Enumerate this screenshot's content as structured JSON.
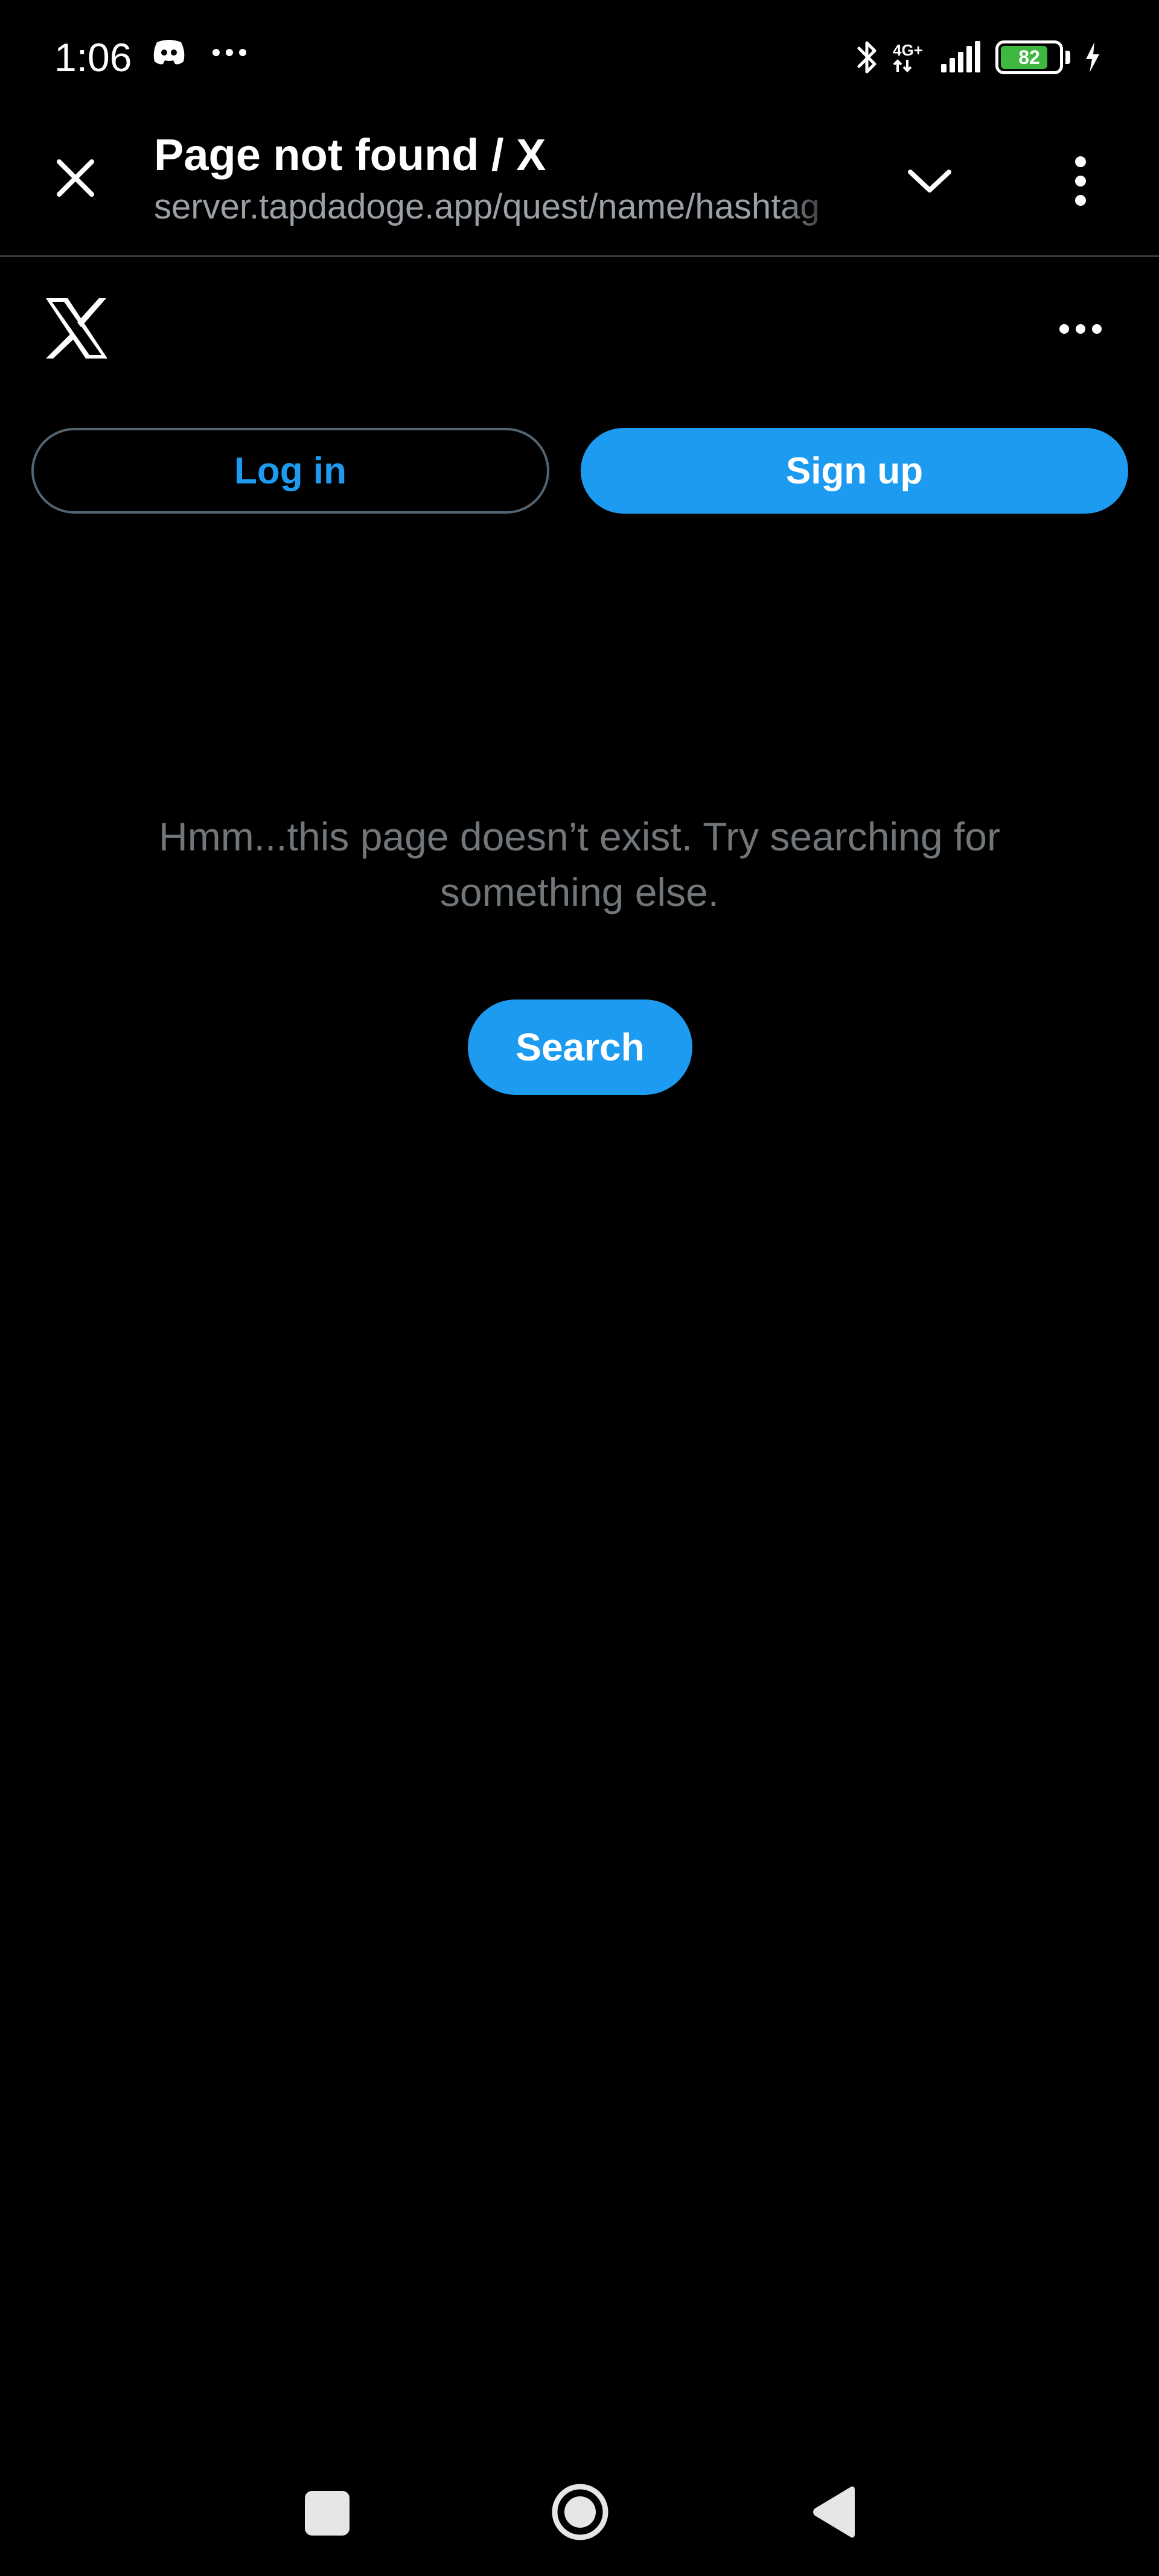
{
  "status_bar": {
    "time": "1:06",
    "network": "4G+",
    "battery_level": "82",
    "battery_fraction": 0.82,
    "icons": [
      "discord-icon",
      "more-dots-icon",
      "bluetooth-icon",
      "signal-icon",
      "battery-icon",
      "charging-icon"
    ]
  },
  "browser": {
    "page_title": "Page not found / X",
    "url": "server.tapdadoge.app/quest/name/hashtag"
  },
  "auth": {
    "login_label": "Log in",
    "signup_label": "Sign up"
  },
  "empty_state": {
    "message": "Hmm...this page doesn’t exist. Try searching for something else.",
    "search_label": "Search"
  },
  "colors": {
    "accent": "#1d9bf0",
    "background": "#000000",
    "muted_text": "#71767b",
    "border": "#536471",
    "battery": "#3fb83f"
  }
}
